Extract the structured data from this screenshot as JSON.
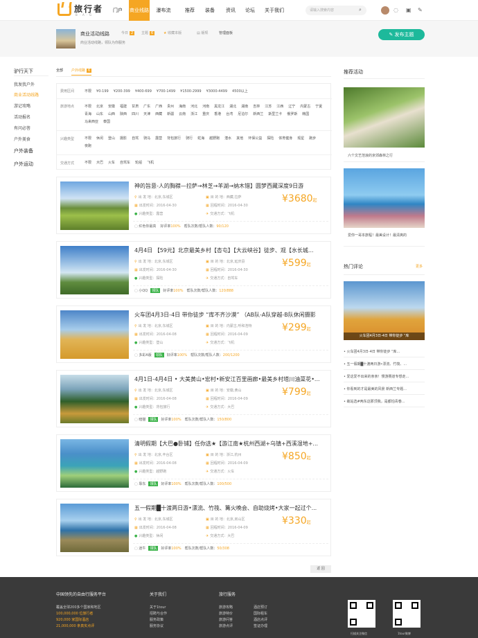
{
  "brand": {
    "name": "旅行者",
    "tagline": "B·A·G"
  },
  "nav": [
    {
      "label": "门户",
      "active": false
    },
    {
      "label": "商业线路",
      "active": true
    },
    {
      "label": "瀑布流",
      "active": false
    },
    {
      "label": "推荐",
      "active": false
    },
    {
      "label": "装备",
      "active": false
    },
    {
      "label": "资讯",
      "active": false
    },
    {
      "label": "论坛",
      "active": false
    },
    {
      "label": "关于我们",
      "active": false
    }
  ],
  "search": {
    "placeholder": "请输入搜索内容"
  },
  "group": {
    "title": "商业活动线路",
    "description": "商业活动线路，领队为你服务",
    "stat_today": "今日",
    "stat_today_n": "2",
    "stat_topic": "主题",
    "stat_topic_n": "6",
    "fav": "收藏本版",
    "rule": "版规",
    "admin": "管理面板",
    "post_button": "发布主题"
  },
  "left_nav": {
    "title": "驴行天下",
    "items": [
      "我发我户外",
      "商业活动线路",
      "游记攻略",
      "活动报名",
      "有问必答",
      "户外美食"
    ],
    "sections": [
      "户外装备",
      "户外运动"
    ]
  },
  "tabs": {
    "all": "全部",
    "current": "户外线路",
    "count": "6"
  },
  "filters": [
    {
      "label": "费用区间",
      "options": [
        "不限",
        "¥0-199",
        "¥200-399",
        "¥400-699",
        "¥700-1499",
        "¥1500-2999",
        "¥3000-4499",
        "4500以上"
      ]
    },
    {
      "label": "旅游地点",
      "options": [
        "不限",
        "北京",
        "安徽",
        "福建",
        "甘肃",
        "广东",
        "广西",
        "贵州",
        "海南",
        "河北",
        "河南",
        "黑龙江",
        "湖北",
        "湖南",
        "吉林",
        "江苏",
        "江西",
        "辽宁",
        "内蒙古",
        "宁夏",
        "青海",
        "山东",
        "山西",
        "陕西",
        "四川",
        "天津",
        "西藏",
        "新疆",
        "云南",
        "浙江",
        "重庆",
        "香港",
        "台湾",
        "尼泊尔",
        "新西兰",
        "斯里兰卡",
        "俄罗斯",
        "韩国",
        "马来西亚",
        "泰国"
      ]
    },
    {
      "label": "兴趣类型",
      "options": [
        "不限",
        "休闲",
        "登山",
        "摄影",
        "自驾",
        "骑马",
        "露营",
        "背包旅行",
        "骑行",
        "蛇海",
        "越野跑",
        "潜水",
        "其他",
        "环保公益",
        "探险",
        "体育健身",
        "观星",
        "跑步",
        "夜跑"
      ]
    },
    {
      "label": "交通方式",
      "options": [
        "不限",
        "大巴",
        "火车",
        "自驾车",
        "轮船",
        "飞机"
      ]
    }
  ],
  "trips": [
    {
      "title": "神的旨意-人的胸襟—拉萨→林芝→羊湖→纳木错】圆梦西藏深度9日游",
      "from": "出 发 地：北京,东城区",
      "to": "目 的 地：西藏,拉萨",
      "depart": "出发时间：2016-04-30",
      "return": "回程时间：2016-04-30",
      "interest": "兴趣类型：露营",
      "transport": "交通方式：飞机",
      "price": "¥3680",
      "price_unit": "起",
      "leader": "红色你最高",
      "level": "",
      "rate_label": "好评率",
      "rate": "100%",
      "people_label": "帮队次数/帮队人数：",
      "people": "90/120"
    },
    {
      "title": "4月4日 【59元】北京最美乡村【杏屯】【大云峡谷】徒步、观【水长城...",
      "from": "出 发 地：北京,东城区",
      "to": "目 的 地：北京,延庆县",
      "depart": "出发时间：2016-04-30",
      "return": "回程时间：2016-04-30",
      "interest": "兴趣类型：探险",
      "transport": "交通方式：自驾车",
      "price": "¥599",
      "price_unit": "起",
      "leader": "小QQ",
      "level": "领队",
      "rate_label": "好评率",
      "rate": "100%",
      "people_label": "帮队次数/帮队人数：",
      "people": "120/888"
    },
    {
      "title": "火车团4月3日-4日 带你徒步 “库不齐沙漠” （AB队-A队穿越-B队休闲摄影",
      "from": "出 发 地：北京,东城区",
      "to": "目 的 地：内蒙古,呼和浩特",
      "depart": "出发时间：2016-04-08",
      "return": "回程时间：2016-04-09",
      "interest": "兴趣类型：登山",
      "transport": "交通方式：飞机",
      "price": "¥299",
      "price_unit": "起",
      "leader": "多彩A版",
      "level": "领队",
      "rate_label": "好评率",
      "rate": "100%",
      "people_label": "帮队次数/帮队人数：",
      "people": "200/1200"
    },
    {
      "title": "4月1日-4月4日 • 大美黄山•宏村•新安江百里画廊•最美乡村塔川油菜花•...",
      "from": "出 发 地：北京,东城区",
      "to": "目 的 地：安徽,黄山",
      "depart": "出发时间：2016-04-08",
      "return": "回程时间：2016-04-09",
      "interest": "兴趣类型：背包旅行",
      "transport": "交通方式：大巴",
      "price": "¥799",
      "price_unit": "起",
      "leader": "暗猫",
      "level": "领队",
      "rate_label": "好评率",
      "rate": "100%",
      "people_label": "帮队次数/帮队人数：",
      "people": "150/800"
    },
    {
      "title": "清明假期【大巴●卧铺】任你选★【游江南★杭州西湖+乌镇+西溪湿地+...",
      "from": "出 发 地：北京,丰台区",
      "to": "目 的 地：浙江,杭州",
      "depart": "出发时间：2016-04-08",
      "return": "回程时间：2016-04-09",
      "interest": "兴趣类型：越野跑",
      "transport": "交通方式：火车",
      "price": "¥850",
      "price_unit": "起",
      "leader": "靠东",
      "level": "领队",
      "rate_label": "好评率",
      "rate": "100%",
      "people_label": "帮队次数/帮队人数：",
      "people": "100/500"
    },
    {
      "title": "五一假期█十渡两日游•漂流、竹筏、篝火晚会、自助烧烤•大家一起过个...",
      "from": "出 发 地：北京,东城区",
      "to": "目 的 地：北京,房山区",
      "depart": "出发时间：2016-04-08",
      "return": "回程时间：2016-04-09",
      "interest": "兴趣类型：休闲",
      "transport": "交通方式：大巴",
      "price": "¥330",
      "price_unit": "起",
      "leader": "迷牛",
      "level": "领队",
      "rate_label": "好评率",
      "rate": "100%",
      "people_label": "帮队次数/帮队人数：",
      "people": "50/308"
    }
  ],
  "pagination": {
    "back": "返 回"
  },
  "right": {
    "recommend_title": "推荐活动",
    "rec1_caption": "六个文艺范浪的京郊森林之行",
    "rec2_caption": "爱你一哥本旅程！最美设计！最清爽的",
    "hot_title": "热门评论",
    "more": "更多",
    "hot_caption": "火车团4月3日-4日 带你徒步 \"库",
    "hot_list": [
      "火车团4月3日-4日 带你徒步 \"库...",
      "五一假期█十渡两日游•漂流、竹筏、...",
      "爱这爱不出来的亲亲！慢游赛道专想走...",
      "你看到的才是最美的风景 新西兰专题...",
      "栽站选#两东这那顶我，是都怕青春..."
    ]
  },
  "footer": {
    "col1_title": "中国领先的自由行服务平台",
    "col1_lines": [
      "覆盖全球200多个国家和地区",
      "100,000,000 位旅行者",
      "920,000 家国际酒店",
      "21,000,000 条真实点评"
    ],
    "col2_title": "关于我们",
    "col2_lines": [
      "关于1tour",
      "招聘与合作",
      "服务政策",
      "服务协议"
    ],
    "col3_title": "旅行服务",
    "col3a": [
      "旅游攻略",
      "旅游特价",
      "旅游问答",
      "旅游点评"
    ],
    "col3b": [
      "酒店预订",
      "国际租车",
      "酒店点评",
      "签证办理"
    ],
    "qr1": "扫描关注微信",
    "qr2": "1tour微博"
  }
}
